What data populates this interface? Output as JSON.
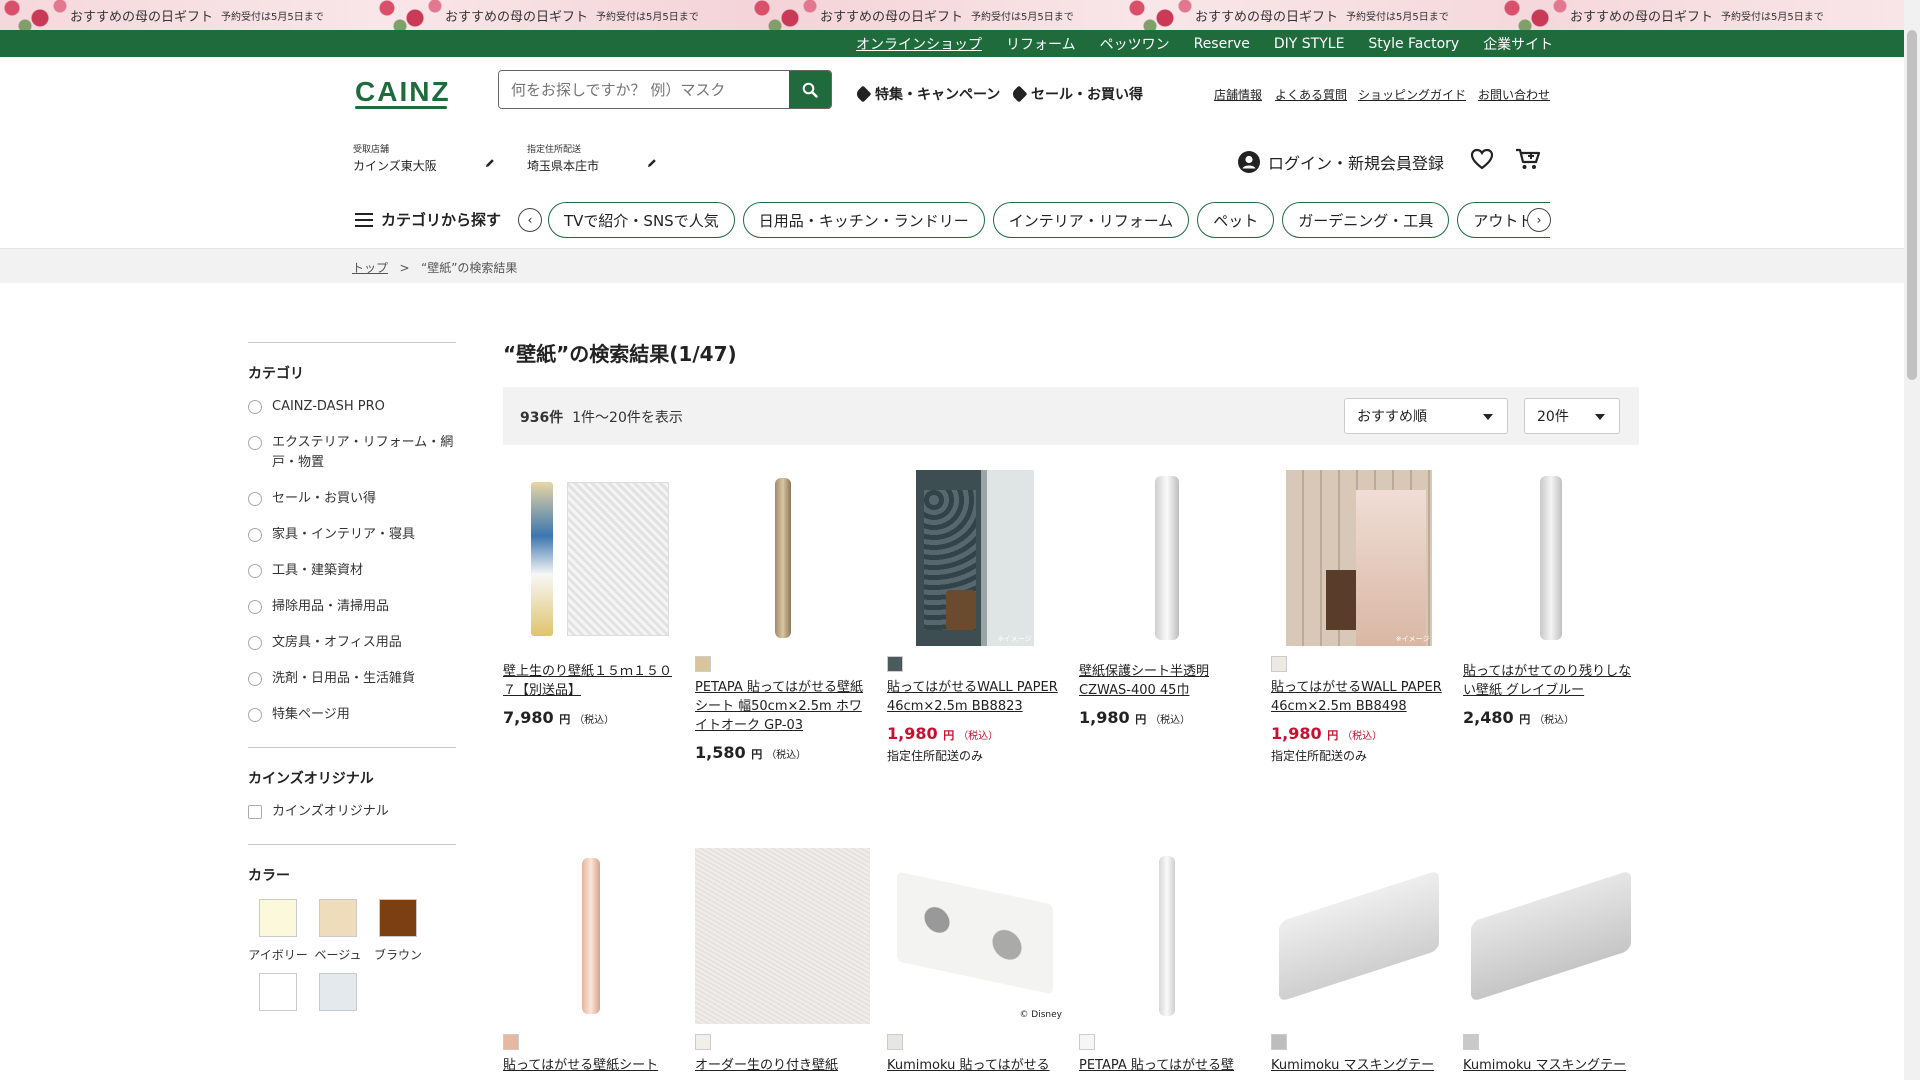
{
  "promo": {
    "main": "おすすめの母の日ギフト",
    "sub": "予約受付は5月5日まで",
    "repeat": 5
  },
  "topnav": [
    "オンラインショップ",
    "リフォーム",
    "ペッツワン",
    "Reserve",
    "DIY STYLE",
    "Style Factory",
    "企業サイト"
  ],
  "header": {
    "logo": "CAINZ",
    "search_placeholder": "何をお探しですか？ 例）マスク",
    "feature_link": "特集・キャンペーン",
    "sale_link": "セール・お買い得",
    "util_links": [
      "店舗情報",
      "よくある質問",
      "ショッピングガイド",
      "お問い合わせ"
    ],
    "store_label": "受取店舗",
    "store_value": "カインズ東大阪",
    "delivery_label": "指定住所配送",
    "delivery_value": "埼玉県本庄市",
    "login": "ログイン・新規会員登録"
  },
  "catnav": {
    "button": "カテゴリから探す",
    "chips": [
      "TVで紹介・SNSで人気",
      "日用品・キッチン・ランドリー",
      "インテリア・リフォーム",
      "ペット",
      "ガーデニング・工具",
      "アウトドア・カー用品"
    ]
  },
  "breadcrumb": {
    "home": "トップ",
    "sep": ">",
    "current": "“壁紙”の検索結果"
  },
  "sidebar": {
    "category_title": "カテゴリ",
    "categories": [
      "CAINZ-DASH PRO",
      "エクステリア・リフォーム・網戸・物置",
      "セール・お買い得",
      "家具・インテリア・寝具",
      "工具・建築資材",
      "掃除用品・清掃用品",
      "文房具・オフィス用品",
      "洗剤・日用品・生活雑貨",
      "特集ページ用"
    ],
    "original_title": "カインズオリジナル",
    "original_option": "カインズオリジナル",
    "color_title": "カラー",
    "colors": [
      {
        "name": "アイボリー",
        "hex": "#fbf8dc"
      },
      {
        "name": "ベージュ",
        "hex": "#efdcbb"
      },
      {
        "name": "ブラウン",
        "hex": "#7b3f12"
      },
      {
        "name": "",
        "hex": "#ffffff"
      },
      {
        "name": "",
        "hex": "#e3e9ec"
      }
    ]
  },
  "results": {
    "title": "“壁紙”の検索結果(1/47)",
    "count": "936件",
    "range": "1件～20件を表示",
    "sort": "おすすめ順",
    "per_page": "20件"
  },
  "products": [
    {
      "name": "壁上生のり壁紙１５ｍ１５０７【別送品】",
      "price": "7,980",
      "unit": "円",
      "tax": "（税込）",
      "sale": false,
      "note": "",
      "swatch": ""
    },
    {
      "name": "PETAPA 貼ってはがせる壁紙シート 幅50cm×2.5m ホワイトオーク GP-03",
      "price": "1,580",
      "unit": "円",
      "tax": "（税込）",
      "sale": false,
      "note": "",
      "swatch": "#d9c59a"
    },
    {
      "name": "貼ってはがせるWALL PAPER 46cm×2.5m BB8823",
      "price": "1,980",
      "unit": "円",
      "tax": "（税込）",
      "sale": true,
      "note": "指定住所配送のみ",
      "swatch": "#4b5a5c"
    },
    {
      "name": "壁紙保護シート半透明 CZWAS-400 45巾",
      "price": "1,980",
      "unit": "円",
      "tax": "（税込）",
      "sale": false,
      "note": "",
      "swatch": ""
    },
    {
      "name": "貼ってはがせるWALL PAPER 46cm×2.5m BB8498",
      "price": "1,980",
      "unit": "円",
      "tax": "（税込）",
      "sale": true,
      "note": "指定住所配送のみ",
      "swatch": "#ece8e2"
    },
    {
      "name": "貼ってはがせてのり残りしない壁紙 グレイブルー",
      "price": "2,480",
      "unit": "円",
      "tax": "（税込）",
      "sale": false,
      "note": "",
      "swatch": ""
    },
    {
      "name": "貼ってはがせる壁紙シート",
      "swatch": "#e8b7a0"
    },
    {
      "name": "オーダー生のり付き壁紙",
      "swatch": "#f2eeea"
    },
    {
      "name": "Kumimoku 貼ってはがせる",
      "swatch": "#e6e6e2"
    },
    {
      "name": "PETAPA 貼ってはがせる壁",
      "swatch": "#f6f6f6"
    },
    {
      "name": "Kumimoku マスキングテー",
      "swatch": "#bdbdbd"
    },
    {
      "name": "Kumimoku マスキングテー",
      "swatch": "#c9c9c9"
    }
  ],
  "image_texts": {
    "disney": "© Disney",
    "image_tag": "※イメージ"
  }
}
